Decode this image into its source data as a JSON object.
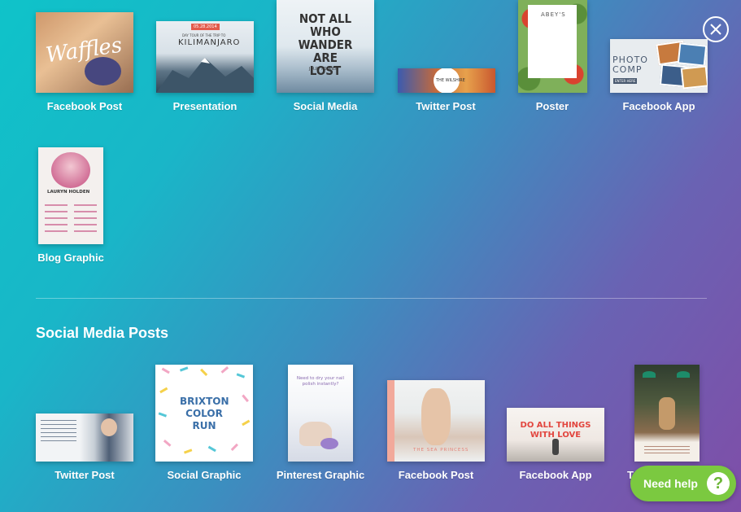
{
  "close": {
    "icon": "close-icon"
  },
  "templates_top": [
    {
      "label": "Facebook Post",
      "thumb_text": "Waffles"
    },
    {
      "label": "Presentation",
      "thumb_badge": "05.28.2014",
      "thumb_small": "DAY TOUR OF THE TRIP TO",
      "thumb_title": "KILIMANJARO"
    },
    {
      "label": "Social Media",
      "thumb_title": "NOT ALL WHO WANDER ARE LOST",
      "thumb_small": "J.R.R. TOLKIEN"
    },
    {
      "label": "Twitter Post",
      "thumb_title": "THE WILSHIRE"
    },
    {
      "label": "Poster",
      "thumb_title": "ABEY'S"
    },
    {
      "label": "Facebook App",
      "thumb_title": "PHOTO COMP",
      "thumb_small": "ENTER HERE"
    },
    {
      "label": "Blog Graphic",
      "thumb_title": "LAURYN HOLDEN"
    }
  ],
  "section": {
    "title": "Social Media Posts"
  },
  "templates_social": [
    {
      "label": "Twitter Post"
    },
    {
      "label": "Social Graphic",
      "thumb_title": "BRIXTON COLOR RUN"
    },
    {
      "label": "Pinterest Graphic",
      "thumb_title": "Need to dry your nail polish instantly?"
    },
    {
      "label": "Facebook Post",
      "thumb_title": "THE SEA PRINCESS"
    },
    {
      "label": "Facebook App",
      "thumb_title": "DO ALL THINGS WITH LOVE"
    },
    {
      "label": "T"
    }
  ],
  "help": {
    "label": "Need help",
    "icon": "question-icon",
    "glyph": "?"
  }
}
